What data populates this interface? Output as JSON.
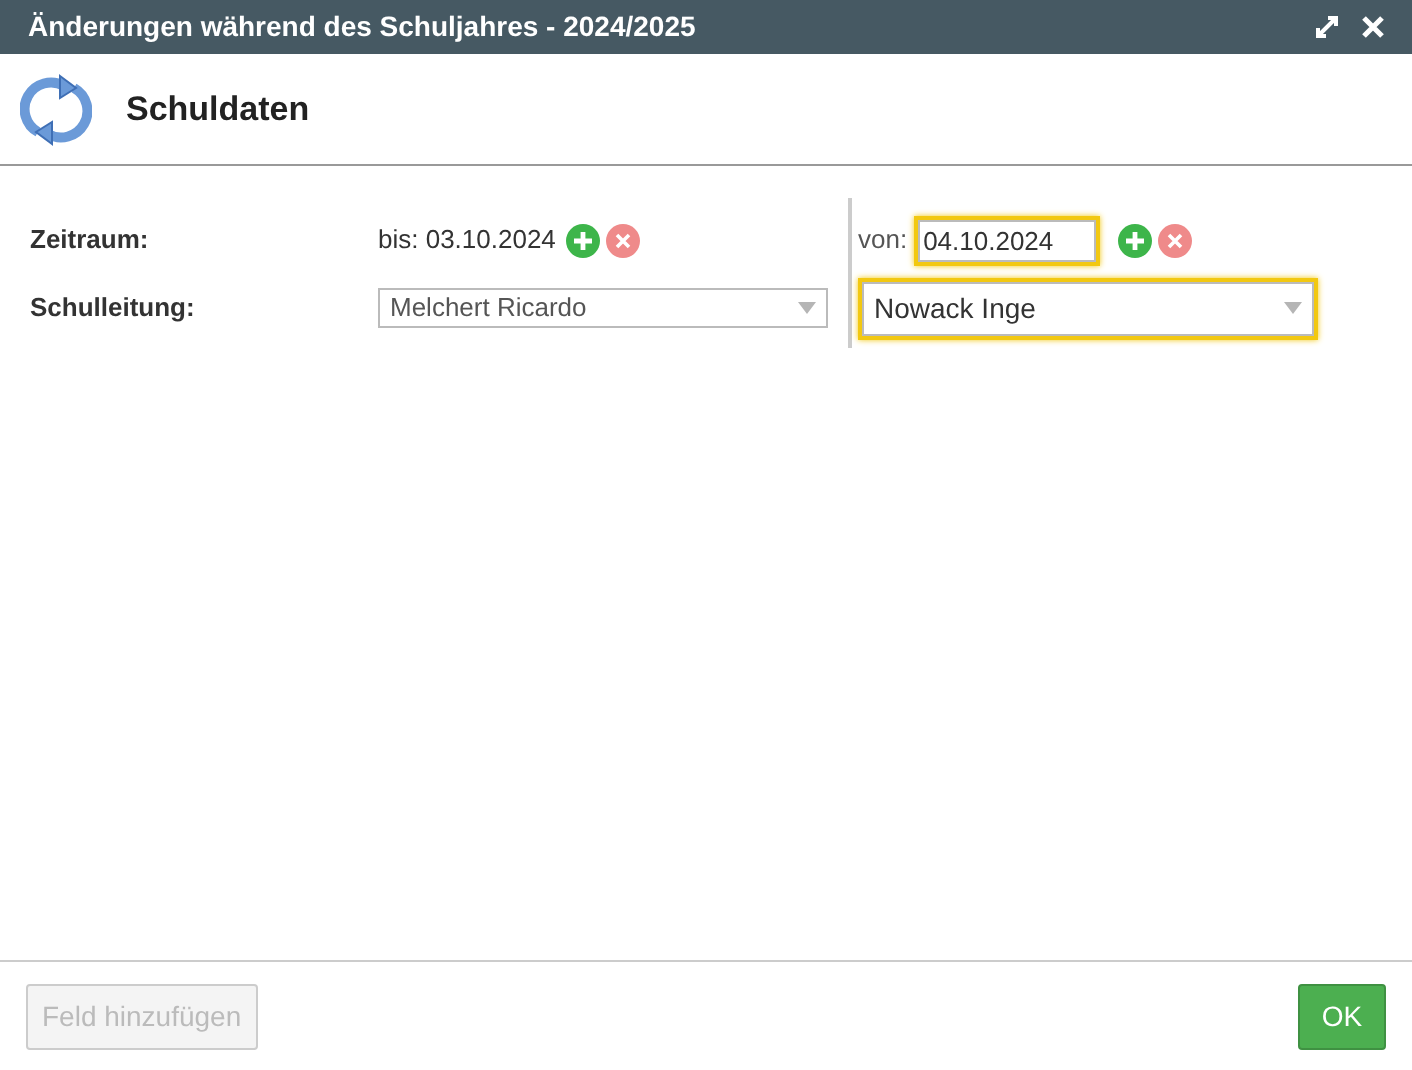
{
  "window": {
    "title": "Änderungen während des Schuljahres - 2024/2025"
  },
  "header": {
    "title": "Schuldaten"
  },
  "fields": [
    {
      "kind": "period",
      "label": "Zeitraum:",
      "current": {
        "value": "bis: 03.10.2024"
      },
      "new": {
        "prefix": "von:",
        "value": "04.10.2024",
        "highlighted": true
      }
    },
    {
      "kind": "select",
      "label": "Schulleitung:",
      "current": {
        "value": "Melchert Ricardo"
      },
      "new": {
        "value": "Nowack Inge",
        "highlighted": true
      }
    }
  ],
  "footer": {
    "add_button": {
      "label": "Feld hinzufügen",
      "disabled": true
    },
    "ok_button": {
      "label": "OK"
    }
  }
}
